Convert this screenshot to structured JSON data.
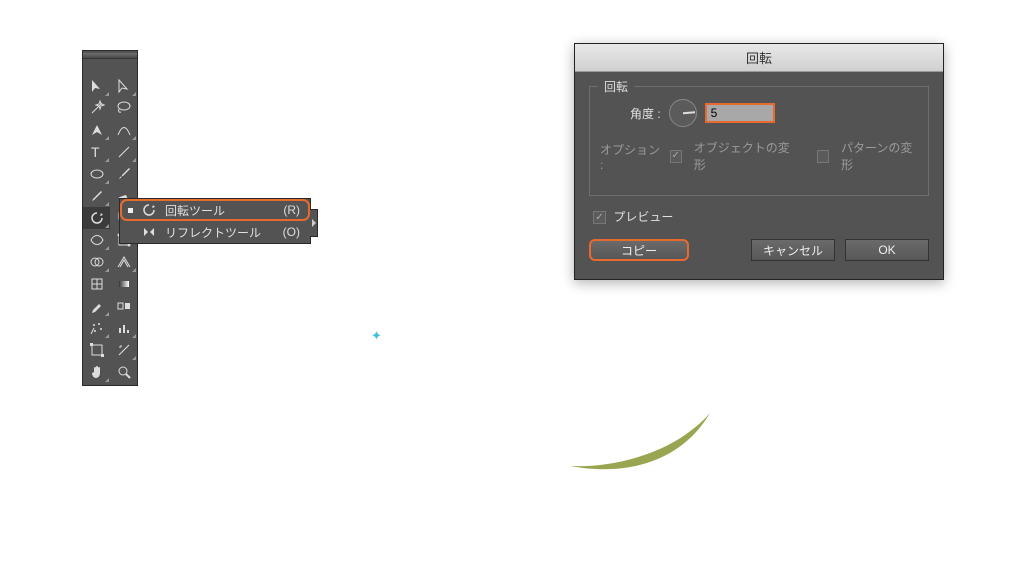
{
  "dialog": {
    "title": "回転",
    "fieldset_legend": "回転",
    "angle_label": "角度 :",
    "angle_value": "5",
    "option_label": "オプション :",
    "option_transform_objects": "オブジェクトの変形",
    "option_transform_patterns": "パターンの変形",
    "preview_label": "プレビュー",
    "buttons": {
      "copy": "コピー",
      "cancel": "キャンセル",
      "ok": "OK"
    }
  },
  "flyout": {
    "rotate": {
      "label": "回転ツール",
      "key": "(R)"
    },
    "reflect": {
      "label": "リフレクトツール",
      "key": "(O)"
    }
  },
  "tools": [
    "selection-tool",
    "direct-selection-tool",
    "magic-wand-tool",
    "lasso-tool",
    "pen-tool",
    "curvature-pen-tool",
    "type-tool",
    "line-segment-tool",
    "ellipse-tool",
    "paintbrush-tool",
    "pencil-tool",
    "eraser-tool",
    "rotate-tool",
    "scale-tool",
    "width-tool",
    "free-transform-tool",
    "shape-builder-tool",
    "perspective-grid-tool",
    "mesh-tool",
    "gradient-tool",
    "eyedropper-tool",
    "blend-tool",
    "symbol-sprayer-tool",
    "column-graph-tool",
    "artboard-tool",
    "slice-tool",
    "hand-tool",
    "zoom-tool"
  ]
}
